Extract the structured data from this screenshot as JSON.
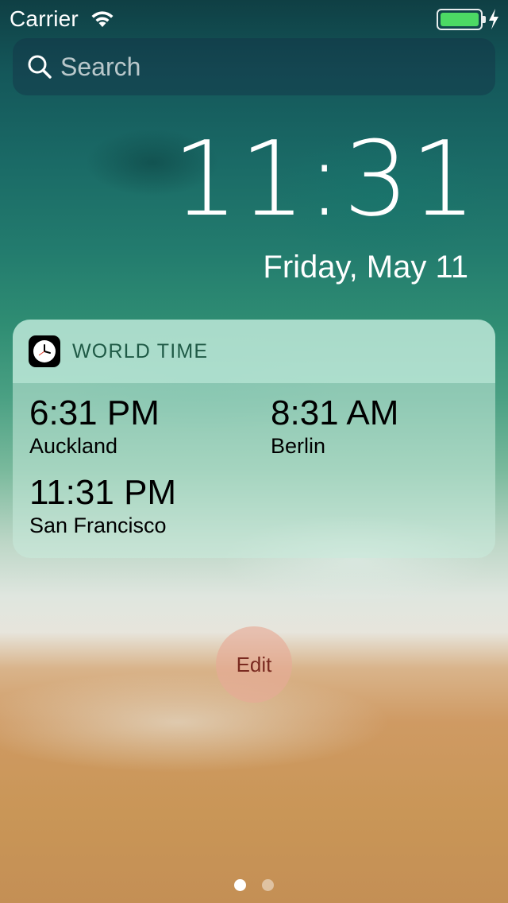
{
  "status_bar": {
    "carrier": "Carrier",
    "wifi_icon": "wifi-icon",
    "battery_icon": "battery-icon",
    "charging_icon": "bolt-icon",
    "battery_level": 1.0,
    "battery_color": "#4cd964"
  },
  "search": {
    "placeholder": "Search",
    "icon": "search-icon"
  },
  "lock_clock": {
    "time": "11:31",
    "date": "Friday, May 11"
  },
  "widget": {
    "title": "WORLD TIME",
    "icon": "clock-icon",
    "clocks": [
      {
        "time": "6:31 PM",
        "city": "Auckland"
      },
      {
        "time": "8:31 AM",
        "city": "Berlin"
      },
      {
        "time": "11:31 PM",
        "city": "San Francisco"
      }
    ]
  },
  "edit_button": {
    "label": "Edit"
  },
  "page_control": {
    "count": 2,
    "active_index": 0
  }
}
